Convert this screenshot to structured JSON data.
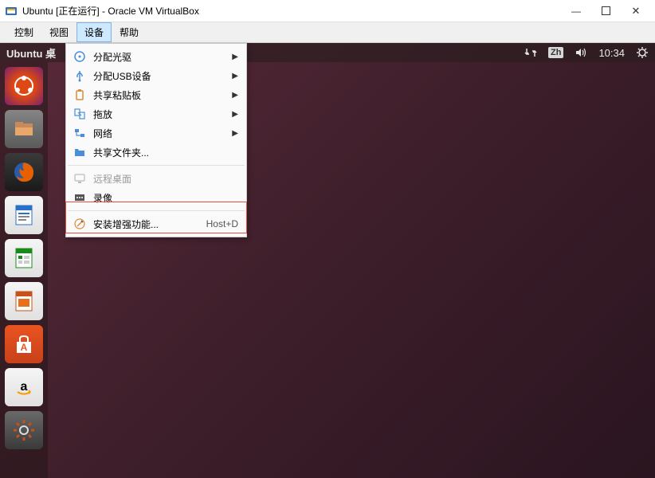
{
  "window": {
    "title": "Ubuntu [正在运行] - Oracle VM VirtualBox"
  },
  "menubar": {
    "items": [
      "控制",
      "视图",
      "设备",
      "帮助"
    ],
    "active_index": 2
  },
  "ubuntu_panel": {
    "title": "Ubuntu 桌",
    "input_method": "Zh",
    "time": "10:34"
  },
  "dropdown": {
    "items": [
      {
        "icon": "disc-icon",
        "label": "分配光驱",
        "submenu": true
      },
      {
        "icon": "usb-icon",
        "label": "分配USB设备",
        "submenu": true
      },
      {
        "icon": "clipboard-icon",
        "label": "共享粘贴板",
        "submenu": true
      },
      {
        "icon": "drag-icon",
        "label": "拖放",
        "submenu": true
      },
      {
        "icon": "network-icon",
        "label": "网络",
        "submenu": true
      },
      {
        "icon": "folder-icon",
        "label": "共享文件夹..."
      },
      {
        "sep": true
      },
      {
        "icon": "remote-icon",
        "label": "远程桌面",
        "disabled": true
      },
      {
        "icon": "record-icon",
        "label": "录像"
      },
      {
        "sep": true
      },
      {
        "icon": "install-icon",
        "label": "安装增强功能...",
        "shortcut": "Host+D",
        "highlighted": true
      }
    ]
  },
  "launcher_apps": [
    "dash",
    "files",
    "firefox",
    "writer",
    "calc",
    "impress",
    "store",
    "amazon",
    "settings"
  ]
}
